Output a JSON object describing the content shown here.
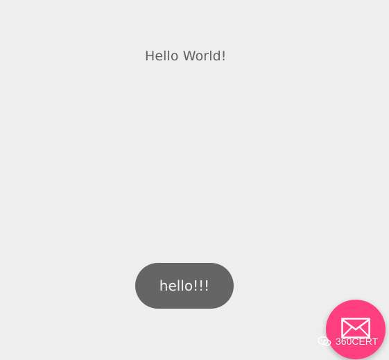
{
  "main": {
    "text": "Hello World!"
  },
  "toast": {
    "text": "hello!!!"
  },
  "fab": {
    "icon": "mail-icon",
    "color": "#ff3f80"
  },
  "watermark": {
    "icon": "wechat-icon",
    "text": "360CERT"
  },
  "colors": {
    "background": "#eeeeee",
    "toast_background": "#656565",
    "text": "#606060"
  }
}
